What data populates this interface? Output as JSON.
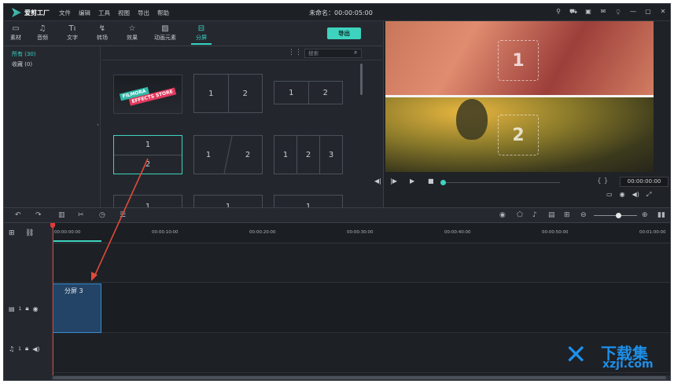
{
  "app": {
    "logo_text": "爱剪工厂",
    "title": "未命名：00:00:05:00",
    "menu": [
      "文件",
      "编辑",
      "工具",
      "视图",
      "导出",
      "帮助"
    ],
    "window_controls": [
      "user-icon",
      "cart-icon",
      "gift-icon",
      "mail-icon",
      "mic-icon",
      "minimize-icon",
      "maximize-icon",
      "close-icon"
    ]
  },
  "toolbar": {
    "items": [
      {
        "label": "素材",
        "icon": "folder-icon"
      },
      {
        "label": "音频",
        "icon": "music-icon"
      },
      {
        "label": "文字",
        "icon": "text-icon"
      },
      {
        "label": "转场",
        "icon": "transition-icon"
      },
      {
        "label": "效果",
        "icon": "effects-icon"
      },
      {
        "label": "动画元素",
        "icon": "image-icon"
      },
      {
        "label": "分屏",
        "icon": "splitscreen-icon"
      }
    ],
    "active": "分屏",
    "export_label": "导出"
  },
  "sidebar": {
    "categories": [
      {
        "label": "所有 (30)",
        "active": true
      },
      {
        "label": "收藏 (0)",
        "active": false
      }
    ]
  },
  "search": {
    "placeholder": "搜索"
  },
  "grid": {
    "fx_a": "FILMORA",
    "fx_b": "EFFECTS STORE",
    "cells": [
      {
        "segments": [
          "1",
          "2"
        ]
      },
      {
        "segments": [
          "1",
          "2"
        ]
      },
      {
        "segments": [
          "1",
          "2"
        ]
      },
      {
        "segments": [
          "1",
          "2"
        ]
      },
      {
        "segments": [
          "1",
          "2",
          "3"
        ]
      },
      {
        "segments": [
          "1"
        ]
      },
      {
        "segments": [
          "1"
        ]
      },
      {
        "segments": [
          "1"
        ]
      }
    ]
  },
  "preview": {
    "drop_top": "1",
    "drop_bottom": "2",
    "timecode": "00:00:00:00",
    "brackets": "{ }"
  },
  "timeline": {
    "ruler": [
      "00:00:00:00",
      "00:00:10:00",
      "00:00:20:00",
      "00:00:30:00",
      "00:00:40:00",
      "00:00:50:00",
      "00:01:00:00"
    ],
    "clip_label": "分屏 3",
    "video_track_label": "1",
    "audio_track_label": "1"
  },
  "watermark": {
    "text": "下载集",
    "url": "xzji.com"
  }
}
